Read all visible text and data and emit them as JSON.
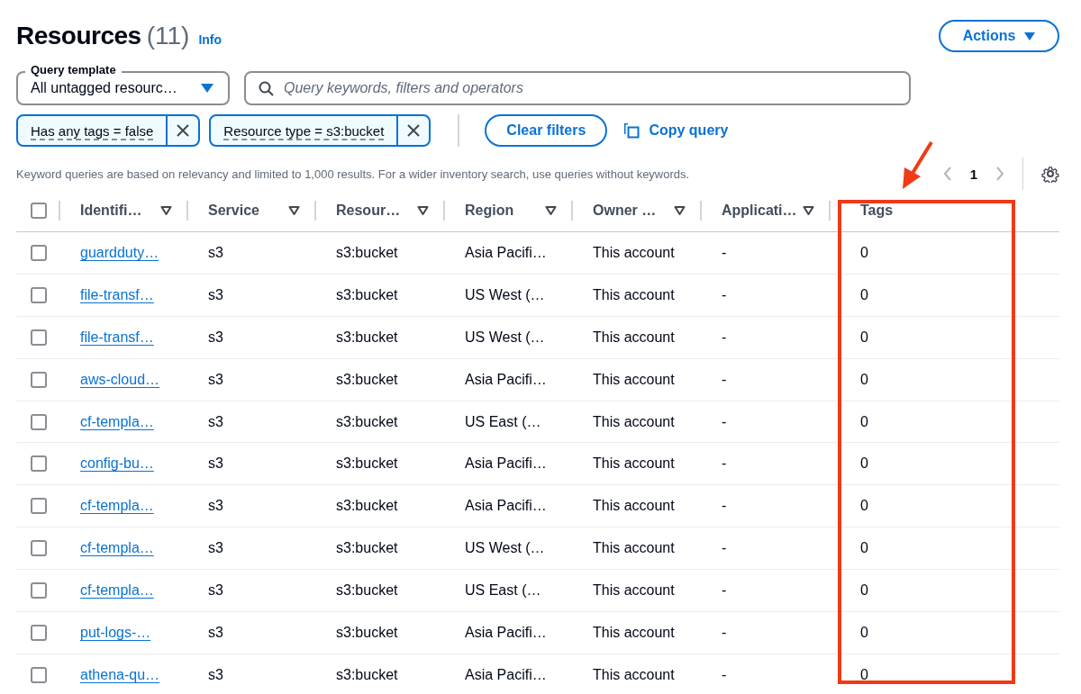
{
  "header": {
    "title": "Resources",
    "count": "(11)",
    "info_link": "Info",
    "actions_button": "Actions"
  },
  "query_template": {
    "label": "Query template",
    "value": "All untagged resourc…"
  },
  "search": {
    "placeholder": "Query keywords, filters and operators"
  },
  "filters": [
    {
      "label": "Has any tags = false"
    },
    {
      "label": "Resource type = s3:bucket"
    }
  ],
  "clear_filters_button": "Clear filters",
  "copy_query_link": "Copy query",
  "note": "Keyword queries are based on relevancy and limited to 1,000 results. For a wider inventory search, use queries without keywords.",
  "pagination": {
    "page": "1"
  },
  "table": {
    "select_all_checked": false,
    "columns": [
      {
        "label": "Identifi…",
        "sortable": true
      },
      {
        "label": "Service",
        "sortable": true
      },
      {
        "label": "Resour…",
        "sortable": true
      },
      {
        "label": "Region",
        "sortable": true
      },
      {
        "label": "Owner …",
        "sortable": true
      },
      {
        "label": "Applicati…",
        "sortable": true
      },
      {
        "label": "Tags",
        "sortable": false
      }
    ],
    "rows": [
      {
        "checked": false,
        "identifier": "guardduty…",
        "service": "s3",
        "type": "s3:bucket",
        "region": "Asia Pacifi…",
        "owner": "This account",
        "application": "-",
        "tags": "0"
      },
      {
        "checked": false,
        "identifier": "file-transf…",
        "service": "s3",
        "type": "s3:bucket",
        "region": "US West (…",
        "owner": "This account",
        "application": "-",
        "tags": "0"
      },
      {
        "checked": false,
        "identifier": "file-transf…",
        "service": "s3",
        "type": "s3:bucket",
        "region": "US West (…",
        "owner": "This account",
        "application": "-",
        "tags": "0"
      },
      {
        "checked": false,
        "identifier": "aws-cloud…",
        "service": "s3",
        "type": "s3:bucket",
        "region": "Asia Pacifi…",
        "owner": "This account",
        "application": "-",
        "tags": "0"
      },
      {
        "checked": false,
        "identifier": "cf-templa…",
        "service": "s3",
        "type": "s3:bucket",
        "region": "US East (…",
        "owner": "This account",
        "application": "-",
        "tags": "0"
      },
      {
        "checked": false,
        "identifier": "config-bu…",
        "service": "s3",
        "type": "s3:bucket",
        "region": "Asia Pacifi…",
        "owner": "This account",
        "application": "-",
        "tags": "0"
      },
      {
        "checked": false,
        "identifier": "cf-templa…",
        "service": "s3",
        "type": "s3:bucket",
        "region": "Asia Pacifi…",
        "owner": "This account",
        "application": "-",
        "tags": "0"
      },
      {
        "checked": false,
        "identifier": "cf-templa…",
        "service": "s3",
        "type": "s3:bucket",
        "region": "US West (…",
        "owner": "This account",
        "application": "-",
        "tags": "0"
      },
      {
        "checked": false,
        "identifier": "cf-templa…",
        "service": "s3",
        "type": "s3:bucket",
        "region": "US East (…",
        "owner": "This account",
        "application": "-",
        "tags": "0"
      },
      {
        "checked": false,
        "identifier": "put-logs-…",
        "service": "s3",
        "type": "s3:bucket",
        "region": "Asia Pacifi…",
        "owner": "This account",
        "application": "-",
        "tags": "0"
      },
      {
        "checked": false,
        "identifier": "athena-qu…",
        "service": "s3",
        "type": "s3:bucket",
        "region": "Asia Pacifi…",
        "owner": "This account",
        "application": "-",
        "tags": "0"
      }
    ]
  }
}
